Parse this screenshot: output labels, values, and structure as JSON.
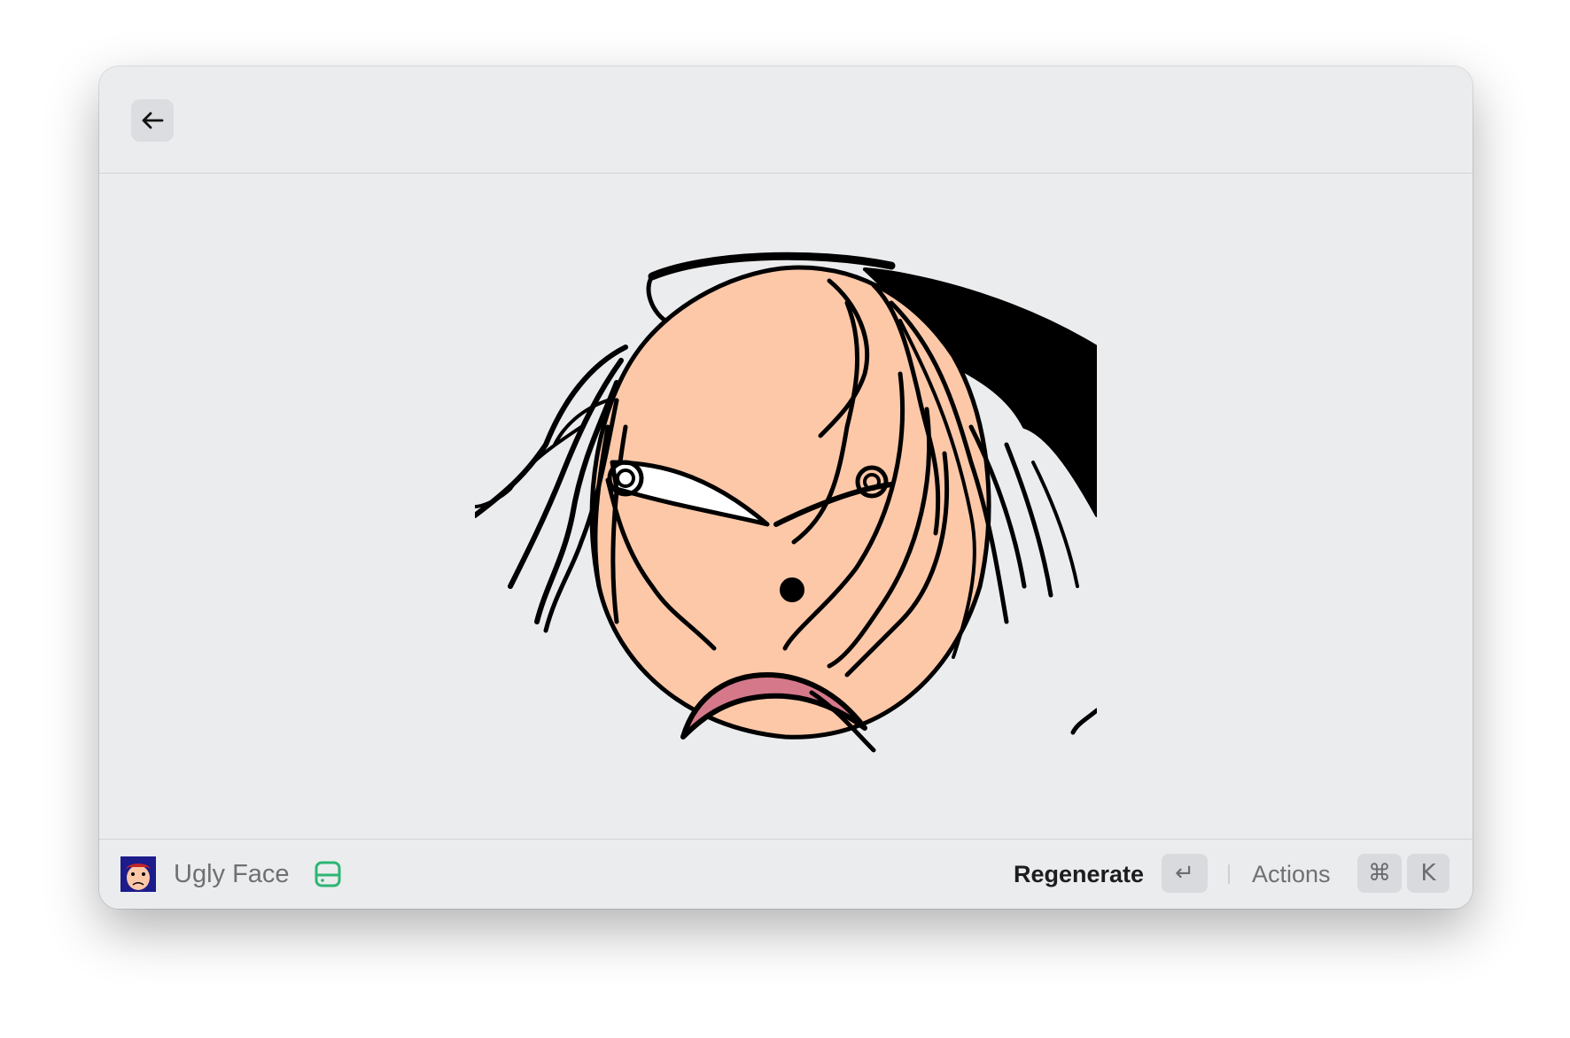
{
  "window": {
    "background": "#ebecee"
  },
  "header": {
    "back_icon": "arrow-left-icon"
  },
  "image": {
    "subject": "drawing-ugly-face",
    "skin_color": "#fdc8a8",
    "hair_color": "#000000",
    "tongue_color": "#d4788a"
  },
  "footer": {
    "app_title": "Ugly Face",
    "storage_icon": "storage-drive-icon",
    "storage_icon_color": "#2bb673",
    "primary_action_label": "Regenerate",
    "primary_action_shortcut": "↵",
    "actions_label": "Actions",
    "actions_shortcut_modifier": "⌘",
    "actions_shortcut_key": "K"
  }
}
